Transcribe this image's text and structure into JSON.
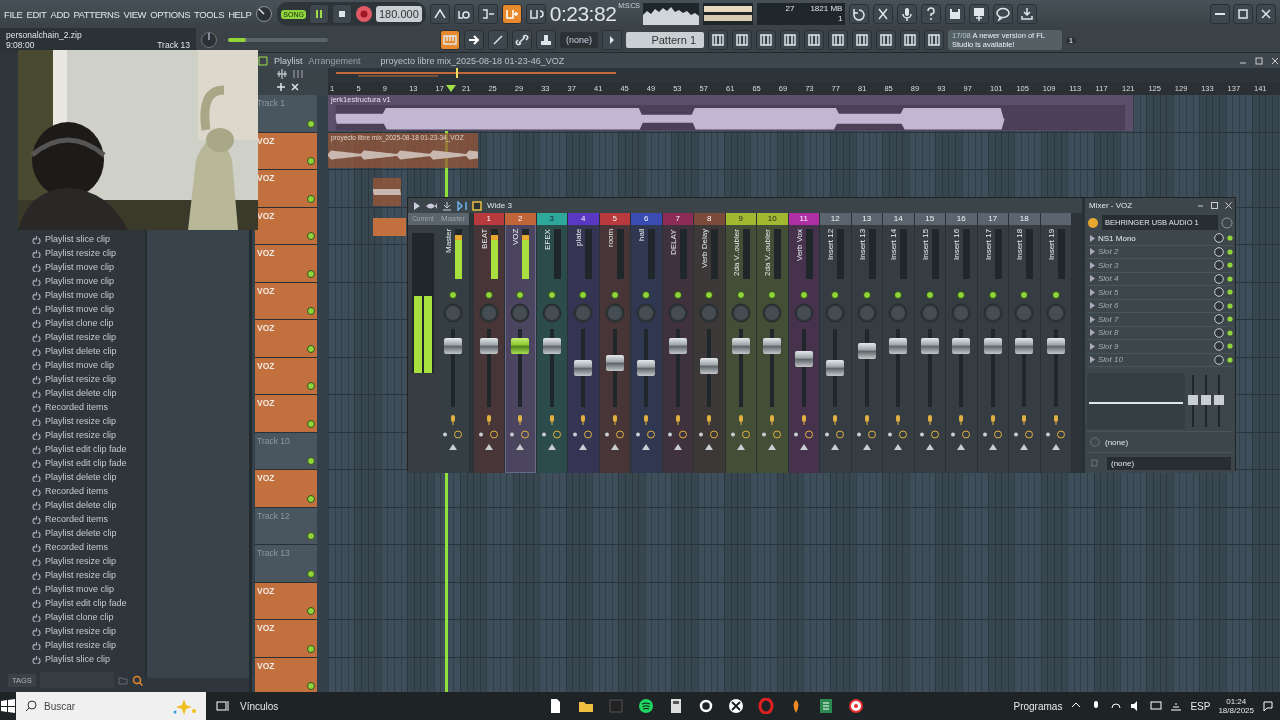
{
  "menu": [
    "FILE",
    "EDIT",
    "ADD",
    "PATTERNS",
    "VIEW",
    "OPTIONS",
    "TOOLS",
    "HELP"
  ],
  "transport": {
    "mode_label": "SONG",
    "song_mode": true,
    "tempo": "180.000",
    "time": "0:23:82",
    "time_unit": "M:S:CS"
  },
  "stats": {
    "voices": "27",
    "memory": "1821 MB",
    "polyphony": "1"
  },
  "hint": {
    "text": "personalchain_2.zip",
    "time": "9:08:00",
    "target": "Track 13"
  },
  "master_pitch": {
    "level": 0.18
  },
  "pattern": {
    "selector": "(none)",
    "name": "Pattern 1"
  },
  "notification": {
    "date": "17/08",
    "message": "A newer version of FL Studio is available!",
    "count": "1"
  },
  "browser": {
    "history": [
      "Playlist slice clip",
      "Playlist resize clip",
      "Playlist move clip",
      "Playlist move clip",
      "Playlist move clip",
      "Playlist move clip",
      "Playlist clone clip",
      "Playlist resize clip",
      "Playlist delete clip",
      "Playlist move clip",
      "Playlist resize clip",
      "Playlist delete clip",
      "Recorded items",
      "Playlist resize clip",
      "Playlist resize clip",
      "Playlist edit clip fade",
      "Playlist edit clip fade",
      "Playlist delete clip",
      "Recorded items",
      "Playlist delete clip",
      "Recorded items",
      "Playlist delete clip",
      "Recorded items",
      "Playlist resize clip",
      "Playlist resize clip",
      "Playlist move clip",
      "Playlist edit clip fade",
      "Playlist clone clip",
      "Playlist resize clip",
      "Playlist resize clip",
      "Playlist slice clip"
    ],
    "tags_label": "TAGS"
  },
  "playlist": {
    "title": "Playlist",
    "subtitle": "Arrangement",
    "project": "proyecto libre mix_2025-08-18 01-23-46_VOZ",
    "ruler": [
      "1",
      "5",
      "9",
      "13",
      "17",
      "21",
      "25",
      "29",
      "33",
      "37",
      "41",
      "45",
      "49",
      "53",
      "57",
      "61",
      "65",
      "69",
      "73",
      "77",
      "81",
      "85",
      "89",
      "93",
      "97",
      "101",
      "105",
      "109",
      "113",
      "117",
      "121",
      "125",
      "129",
      "133",
      "137",
      "141"
    ],
    "tracks": [
      {
        "name": "Track 1",
        "color": "#4a565f",
        "clips": [
          {
            "kind": "full",
            "label": "jerk1estructura v1"
          }
        ]
      },
      {
        "name": "VOZ",
        "color": "#c2703e",
        "clips": [
          {
            "kind": "take",
            "label": "proyecto libre mix_2025-08-18 01-23-34_VOZ"
          }
        ]
      },
      {
        "name": "VOZ",
        "color": "#c2703e",
        "clips": [
          {
            "kind": "small"
          }
        ]
      },
      {
        "name": "VOZ",
        "color": "#c2703e",
        "clips": [
          {
            "kind": "hidden"
          }
        ]
      },
      {
        "name": "VOZ",
        "color": "#c2703e"
      },
      {
        "name": "VOZ",
        "color": "#c2703e"
      },
      {
        "name": "VOZ",
        "color": "#c2703e"
      },
      {
        "name": "VOZ",
        "color": "#c2703e"
      },
      {
        "name": "VOZ",
        "color": "#c2703e"
      },
      {
        "name": "Track 10",
        "color": "#4a565f"
      },
      {
        "name": "VOZ",
        "color": "#c2703e"
      },
      {
        "name": "Track 12",
        "color": "#4a565f"
      },
      {
        "name": "Track 13",
        "color": "#4a565f"
      },
      {
        "name": "VOZ",
        "color": "#c2703e"
      },
      {
        "name": "VOZ",
        "color": "#c2703e"
      },
      {
        "name": "VOZ",
        "color": "#c2703e"
      }
    ]
  },
  "mixer": {
    "preset": "Wide 3",
    "current_label": "Current",
    "current_meter": {
      "level": 0.55
    },
    "master": {
      "header": "Master",
      "name": "Master",
      "level": 0.78,
      "signal": true
    },
    "strips": [
      {
        "number": "1",
        "name": "BEAT",
        "color": "#b83a3e",
        "level": 0.78,
        "signal": true,
        "selected": false
      },
      {
        "number": "2",
        "name": "VOZ",
        "color": "#c0643a",
        "level": 0.78,
        "signal": true,
        "selected": true
      },
      {
        "number": "3",
        "name": "EFEX",
        "color": "#2fa89c",
        "level": 0.78,
        "signal": false,
        "selected": false
      },
      {
        "number": "4",
        "name": "plate",
        "color": "#5b38c4",
        "level": 0.5,
        "signal": false,
        "selected": false
      },
      {
        "number": "5",
        "name": "room",
        "color": "#b83a3e",
        "level": 0.56,
        "signal": false,
        "selected": false
      },
      {
        "number": "6",
        "name": "hall",
        "color": "#3a4cb4",
        "level": 0.5,
        "signal": false,
        "selected": false
      },
      {
        "number": "7",
        "name": "DELAY",
        "color": "#8c2c56",
        "level": 0.78,
        "signal": false,
        "selected": false
      },
      {
        "number": "8",
        "name": "Verb Delay",
        "color": "#7c4a3a",
        "level": 0.52,
        "signal": false,
        "selected": false
      },
      {
        "number": "9",
        "name": "2da V..oubler",
        "color": "#a2b830",
        "level": 0.78,
        "signal": false,
        "selected": false
      },
      {
        "number": "10",
        "name": "2da V..oubler",
        "color": "#a2b830",
        "level": 0.78,
        "signal": false,
        "selected": false
      },
      {
        "number": "11",
        "name": "Verb Vox",
        "color": "#b02ea4",
        "level": 0.62,
        "signal": false,
        "selected": false
      },
      {
        "number": "12",
        "name": "Insert 12",
        "color": "#59646e",
        "level": 0.5,
        "signal": false,
        "selected": false
      },
      {
        "number": "13",
        "name": "Insert 13",
        "color": "#59646e",
        "level": 0.72,
        "signal": false,
        "selected": false
      },
      {
        "number": "14",
        "name": "Insert 14",
        "color": "#59646e",
        "level": 0.78,
        "signal": false,
        "selected": false
      },
      {
        "number": "15",
        "name": "Insert 15",
        "color": "#59646e",
        "level": 0.78,
        "signal": false,
        "selected": false
      },
      {
        "number": "16",
        "name": "Insert 16",
        "color": "#59646e",
        "level": 0.78,
        "signal": false,
        "selected": false
      },
      {
        "number": "17",
        "name": "Insert 17",
        "color": "#59646e",
        "level": 0.78,
        "signal": false,
        "selected": false
      },
      {
        "number": "18",
        "name": "Insert 18",
        "color": "#59646e",
        "level": 0.78,
        "signal": false,
        "selected": false
      },
      {
        "name": "Insert 19",
        "color": "#59646e",
        "level": 0.78,
        "signal": false,
        "selected": false
      }
    ]
  },
  "mixer_panel": {
    "title": "Mixer - VOZ",
    "device": "BEHRINGER USB AUDIO 1",
    "slots": [
      {
        "name": "NS1 Mono",
        "filled": true
      },
      {
        "name": "Slot 2",
        "filled": false
      },
      {
        "name": "Slot 3",
        "filled": false
      },
      {
        "name": "Slot 4",
        "filled": false
      },
      {
        "name": "Slot 5",
        "filled": false
      },
      {
        "name": "Slot 6",
        "filled": false
      },
      {
        "name": "Slot 7",
        "filled": false
      },
      {
        "name": "Slot 8",
        "filled": false
      },
      {
        "name": "Slot 9",
        "filled": false
      },
      {
        "name": "Slot 10",
        "filled": false
      }
    ],
    "eq": "(none)",
    "output": "(none)"
  },
  "taskbar": {
    "search_placeholder": "Buscar",
    "links": "Vínculos",
    "programs": "Programas",
    "language": "ESP",
    "time": "01:24",
    "date": "18/8/2025"
  }
}
